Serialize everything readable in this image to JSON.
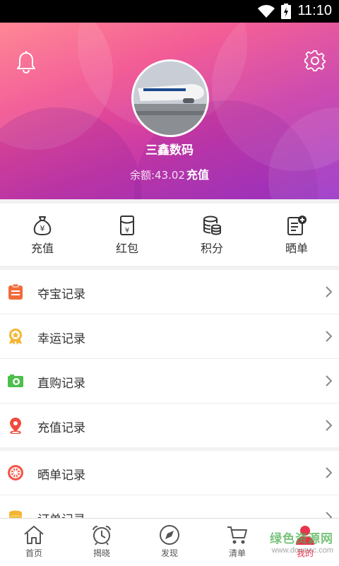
{
  "status_bar": {
    "time": "11:10"
  },
  "profile": {
    "username": "三鑫数码",
    "balance_label": "余额:",
    "balance_value": "43.02",
    "recharge_link": "充值"
  },
  "quick_actions": [
    {
      "label": "充值",
      "icon": "money-bag-icon"
    },
    {
      "label": "红包",
      "icon": "red-envelope-icon"
    },
    {
      "label": "积分",
      "icon": "coins-stack-icon"
    },
    {
      "label": "晒单",
      "icon": "note-plus-icon"
    }
  ],
  "records_group1": [
    {
      "label": "夺宝记录",
      "icon": "clipboard-icon",
      "color": "#f26b3a"
    },
    {
      "label": "幸运记录",
      "icon": "medal-icon",
      "color": "#f3b531"
    },
    {
      "label": "直购记录",
      "icon": "camera-icon",
      "color": "#4cbf4c"
    },
    {
      "label": "充值记录",
      "icon": "location-pin-icon",
      "color": "#ef4a3c"
    }
  ],
  "records_group2": [
    {
      "label": "晒单记录",
      "icon": "wheel-icon",
      "color": "#f2584a"
    },
    {
      "label": "订单记录",
      "icon": "coins-icon",
      "color": "#f3b531"
    }
  ],
  "tabs": [
    {
      "label": "首页",
      "icon": "home-icon"
    },
    {
      "label": "揭晓",
      "icon": "alarm-clock-icon"
    },
    {
      "label": "发现",
      "icon": "compass-icon"
    },
    {
      "label": "清单",
      "icon": "cart-icon"
    },
    {
      "label": "我的",
      "icon": "user-icon",
      "active": true
    }
  ],
  "watermark": {
    "line1": "绿色资源网",
    "line2": "www.downcc.com"
  },
  "colors": {
    "accent": "#e8344e",
    "header_start": "#ff7a8a",
    "header_end": "#9a36c8"
  }
}
